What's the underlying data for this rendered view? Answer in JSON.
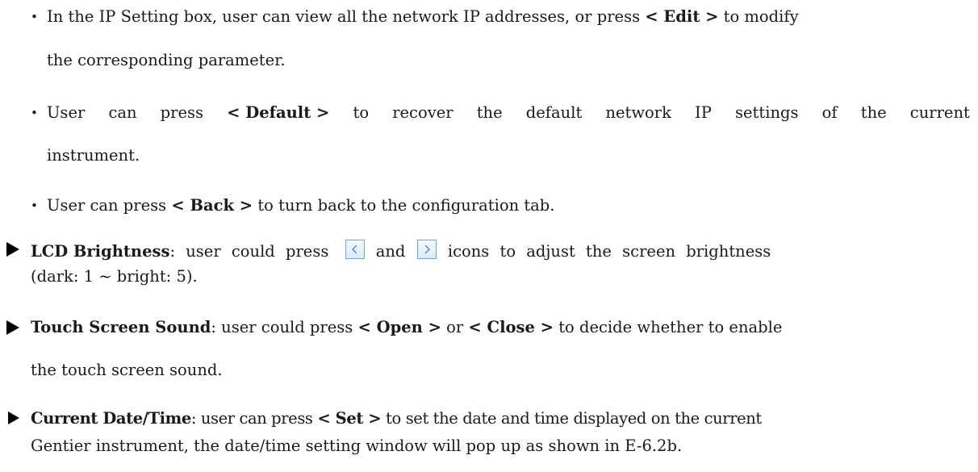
{
  "bullets": [
    {
      "pre": "In the IP Setting box, user can view all the network IP addresses, or press",
      "bold": "< Edit >",
      "post": "to modify",
      "line2": "the corresponding parameter."
    },
    {
      "words": [
        "User",
        "can",
        "press",
        "< Default >",
        "to",
        "recover",
        "the",
        "default",
        "network",
        "IP",
        "settings",
        "of",
        "the",
        "current"
      ],
      "line2": "instrument."
    },
    {
      "pre": "User can press",
      "bold": "< Back >",
      "post": "to turn back to the configuration tab."
    }
  ],
  "lcd": {
    "title": "LCD Brightness",
    "t1": ": user could press",
    "t2": "and",
    "t3": "icons to adjust the screen brightness",
    "line2": "(dark: 1 ~ bright: 5).",
    "left_icon": "chevron-left-icon",
    "right_icon": "chevron-right-icon"
  },
  "sound": {
    "title": "Touch Screen Sound",
    "t1": ": user could press",
    "open": "< Open >",
    "t2": "or",
    "close": "< Close >",
    "t3": "to decide whether to enable",
    "line2": "the touch screen sound."
  },
  "datetime": {
    "title": "Current Date/Time",
    "t1": ": user can press",
    "set": "< Set >",
    "t2": "to set the date and time displayed on the current",
    "line2": "Gentier instrument, the date/time setting window will pop up as shown in E-6.2b."
  }
}
